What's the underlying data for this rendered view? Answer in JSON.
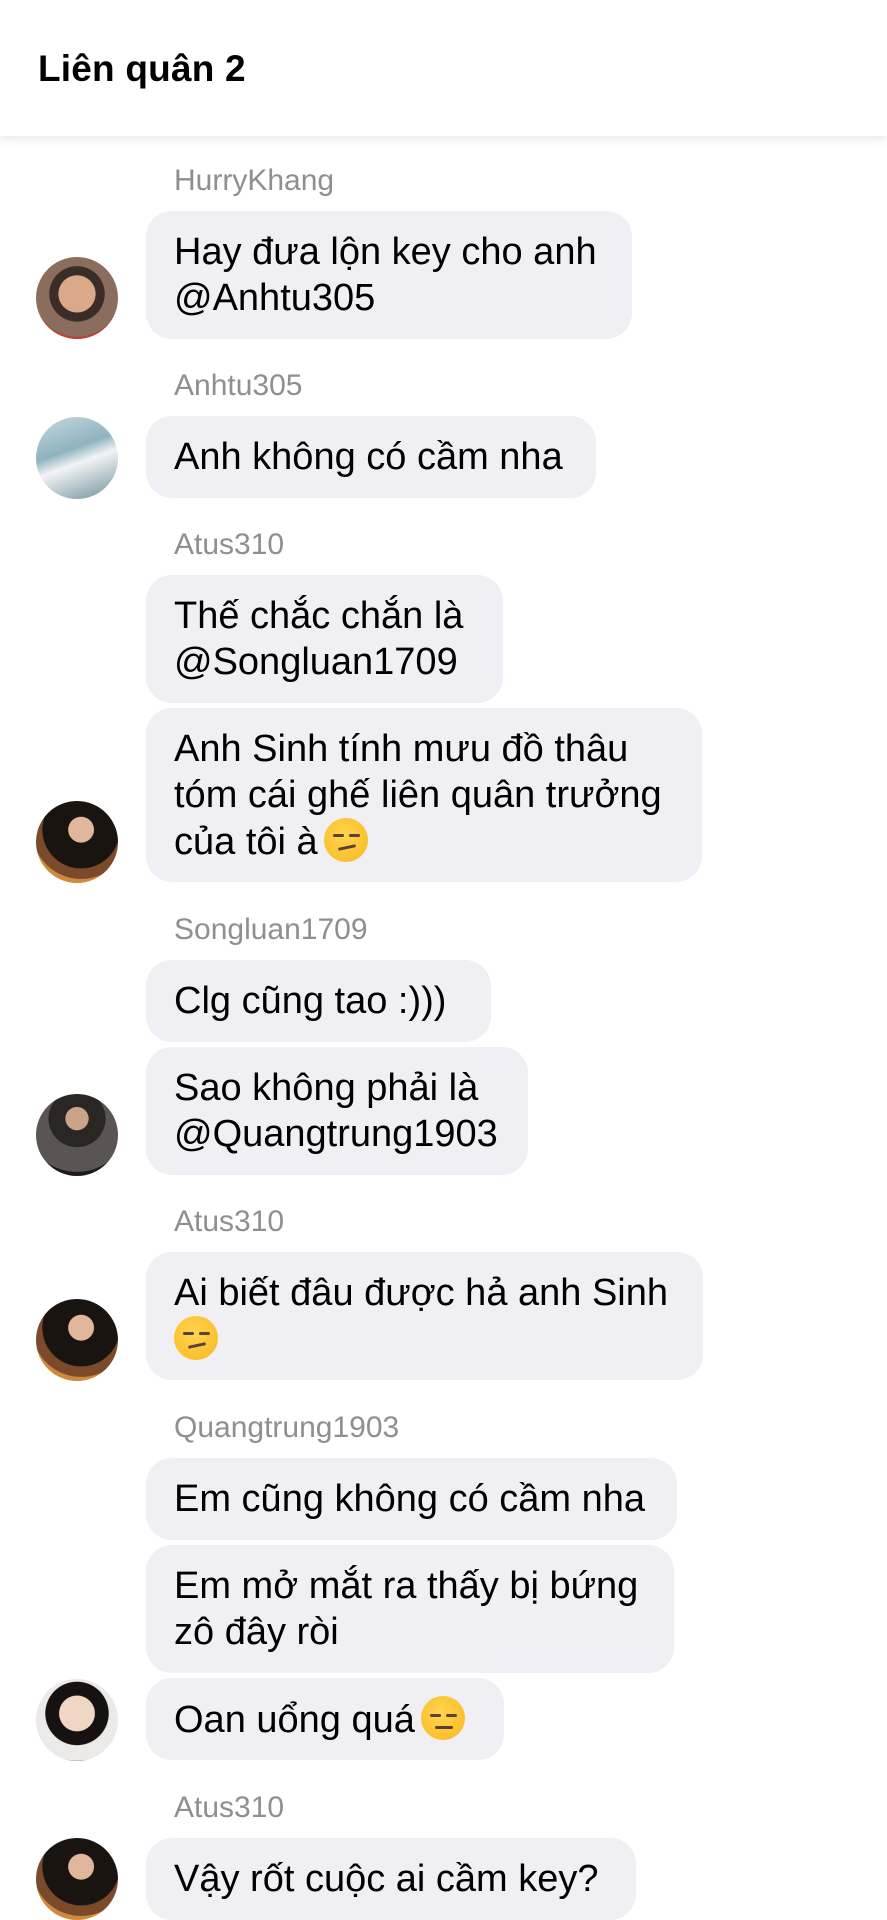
{
  "header": {
    "title": "Liên quân 2"
  },
  "messages": [
    {
      "sender": "HurryKhang",
      "text": "Hay đưa lộn key cho anh\n@Anhtu305"
    },
    {
      "sender": "Anhtu305",
      "text": "Anh không có cầm nha"
    },
    {
      "sender": "Atus310",
      "text1": "Thế chắc chắn là\n@Songluan1709",
      "text2": "Anh Sinh tính mưu đồ thâu\ntóm cái ghế liên quân trưởng\ncủa tôi à",
      "emoji2": "smirk"
    },
    {
      "sender": "Songluan1709",
      "text1": "Clg cũng tao :)))",
      "text2": "Sao không phải là\n@Quangtrung1903"
    },
    {
      "sender": "Atus310",
      "text": "Ai biết đâu được hả anh Sinh",
      "emoji": "smirk"
    },
    {
      "sender": "Quangtrung1903",
      "text1": "Em cũng không có cầm nha",
      "text2": "Em mở mắt ra thấy bị bứng\nzô đây ròi",
      "text3": "Oan uổng quá",
      "emoji3": "pensive"
    },
    {
      "sender": "Atus310",
      "text": "Vậy rốt cuộc ai cầm key?"
    }
  ],
  "colors": {
    "bubble": "#efeff4",
    "sender_name": "#8e8e93"
  }
}
